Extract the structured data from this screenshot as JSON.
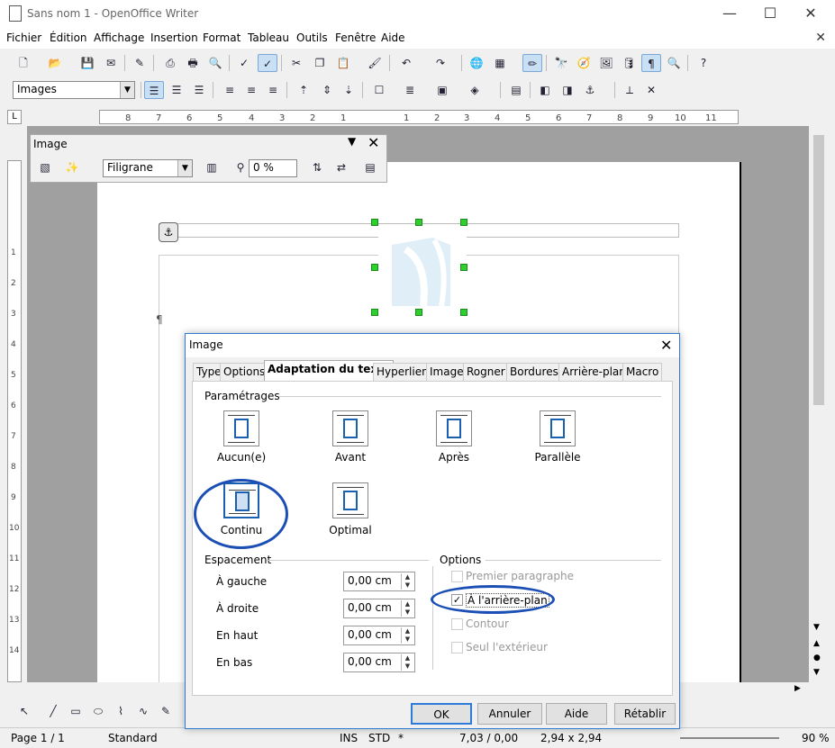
{
  "window": {
    "title": "Sans nom 1 - OpenOffice Writer"
  },
  "menu": [
    "Fichier",
    "Édition",
    "Affichage",
    "Insertion",
    "Format",
    "Tableau",
    "Outils",
    "Fenêtre",
    "Aide"
  ],
  "formatbar": {
    "style_value": "Images"
  },
  "image_toolbar": {
    "title": "Image",
    "filter_value": "Filigrane",
    "transparency": "0 %"
  },
  "dialog": {
    "title": "Image",
    "tabs": [
      "Type",
      "Options",
      "Adaptation du texte",
      "Hyperlien",
      "Image",
      "Rogner",
      "Bordures",
      "Arrière-plan",
      "Macro"
    ],
    "active_tab": "Adaptation du texte",
    "settings_label": "Paramétrages",
    "wraps": [
      "Aucun(e)",
      "Avant",
      "Après",
      "Parallèle",
      "Continu",
      "Optimal"
    ],
    "spacing_label": "Espacement",
    "spacing": [
      {
        "label": "À gauche",
        "value": "0,00 cm"
      },
      {
        "label": "À droite",
        "value": "0,00 cm"
      },
      {
        "label": "En haut",
        "value": "0,00 cm"
      },
      {
        "label": "En bas",
        "value": "0,00 cm"
      }
    ],
    "options_label": "Options",
    "options": [
      {
        "label": "Premier paragraphe",
        "checked": false,
        "enabled": false
      },
      {
        "label": "À l'arrière-plan",
        "checked": true,
        "enabled": true
      },
      {
        "label": "Contour",
        "checked": false,
        "enabled": false
      },
      {
        "label": "Seul l'extérieur",
        "checked": false,
        "enabled": false
      }
    ],
    "buttons": {
      "ok": "OK",
      "cancel": "Annuler",
      "help": "Aide",
      "reset": "Rétablir"
    }
  },
  "statusbar": {
    "page": "Page 1 / 1",
    "style": "Standard",
    "ins": "INS",
    "std": "STD",
    "star": "*",
    "pos": "7,03 / 0,00",
    "size": "2,94 x 2,94",
    "zoom": "90 %"
  },
  "colors": {
    "accent": "#1b4fb5",
    "handle": "#2ece2e"
  }
}
